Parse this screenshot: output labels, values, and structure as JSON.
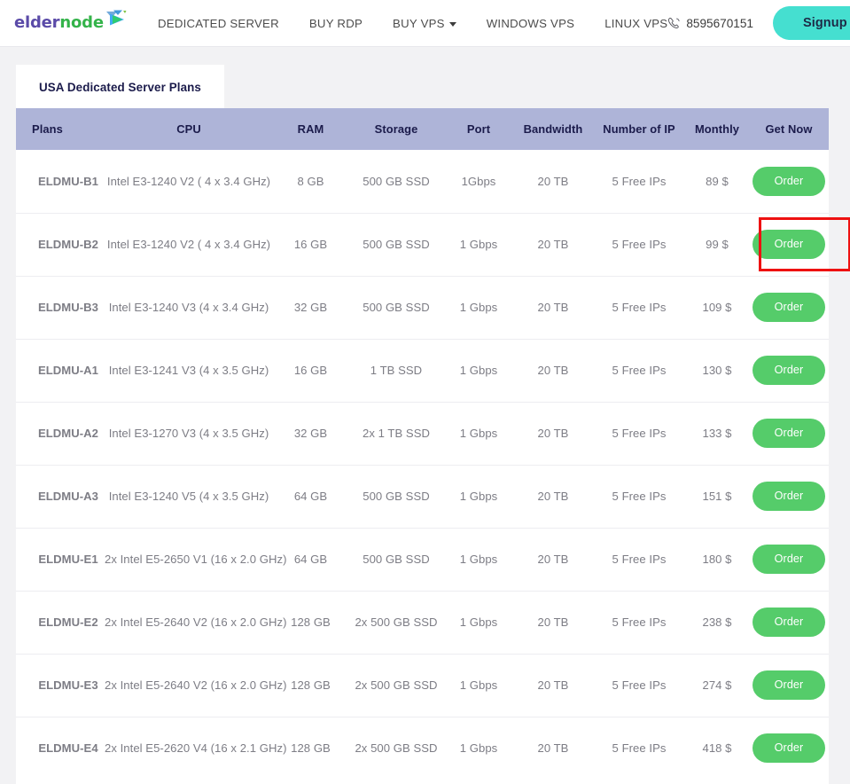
{
  "header": {
    "logo": {
      "part1": "elder",
      "part2": "node",
      "mark": "play-arrow"
    },
    "nav": [
      {
        "label": "DEDICATED SERVER",
        "has_caret": false
      },
      {
        "label": "BUY RDP",
        "has_caret": false
      },
      {
        "label": "BUY VPS",
        "has_caret": true
      },
      {
        "label": "WINDOWS VPS",
        "has_caret": false
      },
      {
        "label": "LINUX VPS",
        "has_caret": false
      }
    ],
    "phone": "8595670151",
    "phone_icon": "phone-icon",
    "signup_label": "Signup"
  },
  "tabs": [
    {
      "label": "USA Dedicated Server Plans",
      "active": true
    }
  ],
  "table": {
    "columns": [
      "Plans",
      "CPU",
      "RAM",
      "Storage",
      "Port",
      "Bandwidth",
      "Number of IP",
      "Monthly",
      "Get Now"
    ],
    "order_label": "Order",
    "rows": [
      {
        "plan": "ELDMU-B1",
        "cpu": "Intel E3-1240 V2 ( 4 x 3.4 GHz)",
        "ram": "8 GB",
        "storage": "500 GB SSD",
        "port": "1Gbps",
        "bandwidth": "20 TB",
        "ip": "5 Free IPs",
        "monthly": "89 $",
        "highlighted": false
      },
      {
        "plan": "ELDMU-B2",
        "cpu": "Intel E3-1240 V2 ( 4 x 3.4 GHz)",
        "ram": "16 GB",
        "storage": "500 GB SSD",
        "port": "1 Gbps",
        "bandwidth": "20 TB",
        "ip": "5 Free IPs",
        "monthly": "99 $",
        "highlighted": true
      },
      {
        "plan": "ELDMU-B3",
        "cpu": "Intel E3-1240 V3 (4 x 3.4 GHz)",
        "ram": "32 GB",
        "storage": "500 GB SSD",
        "port": "1 Gbps",
        "bandwidth": "20 TB",
        "ip": "5 Free IPs",
        "monthly": "109 $",
        "highlighted": false
      },
      {
        "plan": "ELDMU-A1",
        "cpu": "Intel E3-1241 V3 (4 x 3.5 GHz)",
        "ram": "16 GB",
        "storage": "1 TB SSD",
        "port": "1 Gbps",
        "bandwidth": "20 TB",
        "ip": "5 Free IPs",
        "monthly": "130 $",
        "highlighted": false
      },
      {
        "plan": "ELDMU-A2",
        "cpu": "Intel E3-1270 V3 (4 x 3.5 GHz)",
        "ram": "32 GB",
        "storage": "2x 1 TB SSD",
        "port": "1 Gbps",
        "bandwidth": "20 TB",
        "ip": "5 Free IPs",
        "monthly": "133 $",
        "highlighted": false
      },
      {
        "plan": "ELDMU-A3",
        "cpu": "Intel E3-1240 V5 (4 x 3.5 GHz)",
        "ram": "64 GB",
        "storage": "500 GB SSD",
        "port": "1 Gbps",
        "bandwidth": "20 TB",
        "ip": "5 Free IPs",
        "monthly": "151 $",
        "highlighted": false
      },
      {
        "plan": "ELDMU-E1",
        "cpu": "2x Intel E5-2650 V1 (16 x 2.0 GHz)",
        "ram": "64 GB",
        "storage": "500 GB SSD",
        "port": "1 Gbps",
        "bandwidth": "20 TB",
        "ip": "5 Free IPs",
        "monthly": "180 $",
        "highlighted": false
      },
      {
        "plan": "ELDMU-E2",
        "cpu": "2x Intel E5-2640 V2 (16 x 2.0 GHz)",
        "ram": "128 GB",
        "storage": "2x 500 GB SSD",
        "port": "1 Gbps",
        "bandwidth": "20 TB",
        "ip": "5 Free IPs",
        "monthly": "238 $",
        "highlighted": false
      },
      {
        "plan": "ELDMU-E3",
        "cpu": "2x Intel E5-2640 V2 (16 x 2.0 GHz)",
        "ram": "128 GB",
        "storage": "2x 500 GB SSD",
        "port": "1 Gbps",
        "bandwidth": "20 TB",
        "ip": "5 Free IPs",
        "monthly": "274 $",
        "highlighted": false
      },
      {
        "plan": "ELDMU-E4",
        "cpu": "2x Intel E5-2620 V4 (16 x 2.1 GHz)",
        "ram": "128 GB",
        "storage": "2x 500 GB SSD",
        "port": "1 Gbps",
        "bandwidth": "20 TB",
        "ip": "5 Free IPs",
        "monthly": "418 $",
        "highlighted": false
      }
    ]
  },
  "colors": {
    "logo_elder": "#5b4ba8",
    "logo_node": "#34b34a",
    "signup_bg": "#45dfd0",
    "table_header_bg": "#aeb4d8",
    "table_header_text": "#1b1b4b",
    "plan_text": "#3a43b8",
    "order_btn_bg": "#55cc6a",
    "highlight_border": "#ee1111",
    "page_bg": "#f2f2f4"
  }
}
